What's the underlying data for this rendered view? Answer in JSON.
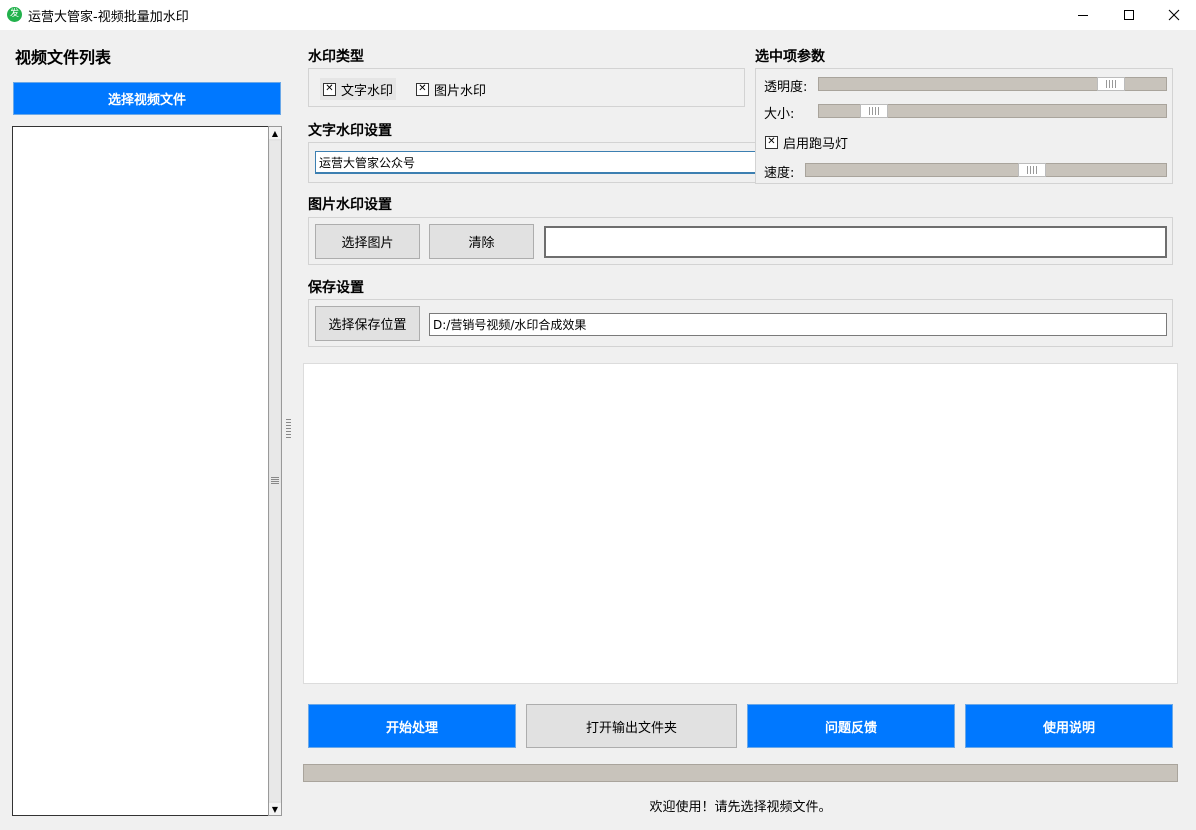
{
  "window": {
    "title": "运营大管家-视频批量加水印",
    "icon_char": "发",
    "icon_color": "#22b14c"
  },
  "left_panel": {
    "title": "视频文件列表",
    "select_button": "选择视频文件",
    "files": []
  },
  "watermark_type": {
    "heading": "水印类型",
    "text_option": {
      "label": "文字水印",
      "checked": true
    },
    "image_option": {
      "label": "图片水印",
      "checked": true
    }
  },
  "text_watermark": {
    "heading": "文字水印设置",
    "value": "运营大管家公众号"
  },
  "selected_params": {
    "heading": "选中项参数",
    "opacity_label": "透明度:",
    "opacity_level": 0.87,
    "size_label": "大小:",
    "size_level": 0.13,
    "marquee": {
      "label": "启用跑马灯",
      "checked": true
    },
    "speed_label": "速度:",
    "speed_level": 0.64
  },
  "image_watermark": {
    "heading": "图片水印设置",
    "select_button": "选择图片",
    "clear_button": "清除",
    "path_value": ""
  },
  "save": {
    "heading": "保存设置",
    "select_button": "选择保存位置",
    "path_value": "D:/营销号视频/水印合成效果"
  },
  "actions": {
    "start": "开始处理",
    "open_output": "打开输出文件夹",
    "feedback": "问题反馈",
    "help": "使用说明"
  },
  "progress": {
    "value": 0
  },
  "status": "欢迎使用！请先选择视频文件。",
  "colors": {
    "accent": "#0078ff",
    "track": "#c8c3bb"
  }
}
